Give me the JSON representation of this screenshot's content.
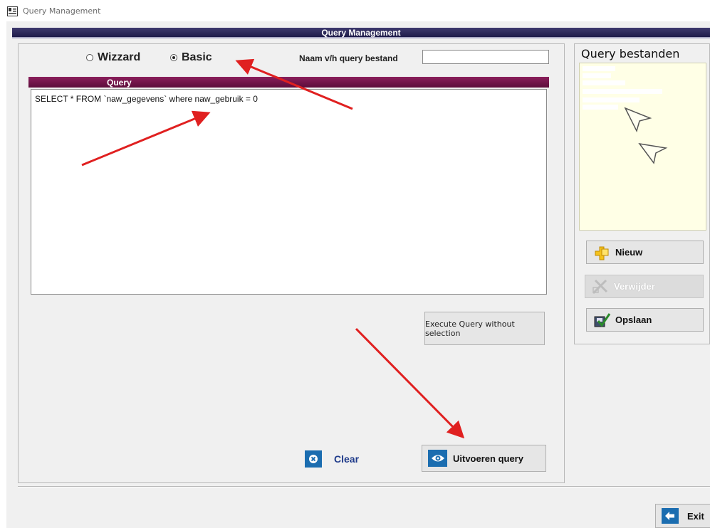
{
  "window": {
    "title": "Query Management"
  },
  "header": {
    "title": "Query Management"
  },
  "mode": {
    "options": [
      {
        "label": "Wizzard",
        "selected": false
      },
      {
        "label": "Basic",
        "selected": true
      }
    ]
  },
  "filename": {
    "label": "Naam v/h query bestand",
    "value": ""
  },
  "query": {
    "header": "Query",
    "text": "SELECT * FROM `naw_gegevens` where naw_gebruik = 0"
  },
  "buttons": {
    "execute_without_selection": "Execute Query without selection",
    "clear": "Clear",
    "run_query": "Uitvoeren query",
    "exit": "Exit"
  },
  "files": {
    "title": "Query bestanden",
    "actions": {
      "new": "Nieuw",
      "delete": "Verwijder",
      "save": "Opslaan"
    }
  },
  "colors": {
    "title_bar": "#2b2858",
    "query_header": "#6e1446",
    "accent_blue": "#1b6db0",
    "list_bg": "#ffffe6",
    "annotation_arrow": "#e02020"
  },
  "icons": [
    "app-icon",
    "clear-icon",
    "eye-icon",
    "new-puzzle-icon",
    "delete-icon",
    "save-check-icon",
    "exit-arrow-icon",
    "cursor-icon"
  ]
}
